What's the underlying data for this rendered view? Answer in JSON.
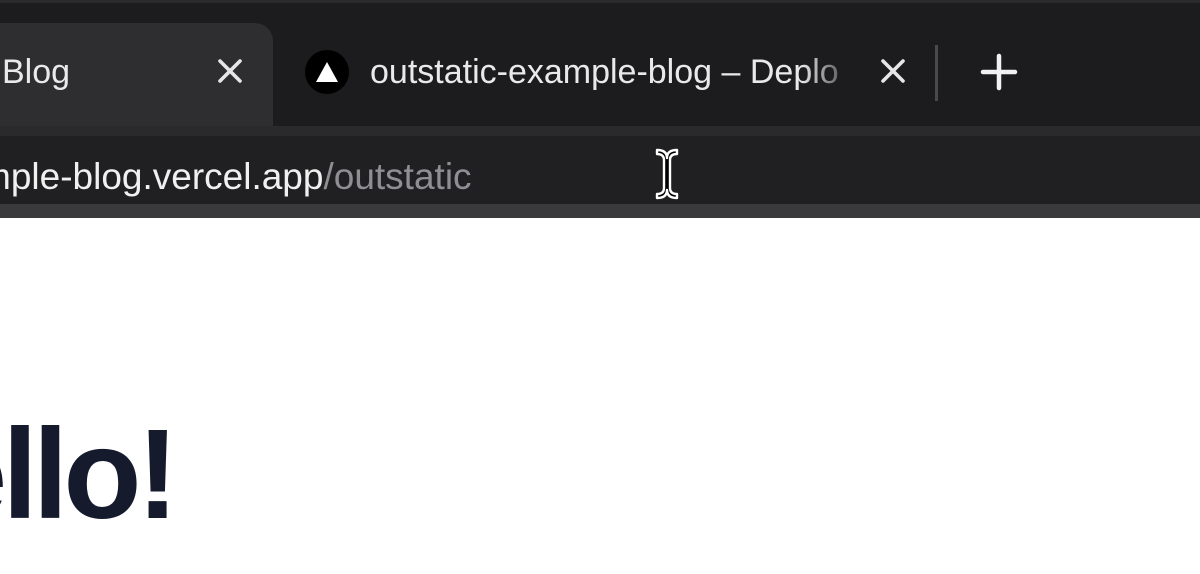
{
  "browser": {
    "tabs": [
      {
        "title": "Blog",
        "active": true
      },
      {
        "title": "outstatic-example-blog – Deplo",
        "active": false,
        "favicon": "vercel-triangle-icon"
      }
    ],
    "new_tab_icon": "plus-icon",
    "close_icon": "close-icon",
    "address_bar": {
      "host": "mple-blog.vercel.app",
      "path": "/outstatic"
    }
  },
  "page": {
    "heading": "ello!"
  },
  "colors": {
    "tabstrip_bg": "#1c1c1e",
    "active_tab_bg": "#2e2e31",
    "address_bar_bg": "#202022",
    "url_text": "#f0f0f0",
    "url_path_text": "#8e8e93",
    "heading_text": "#151a2d"
  }
}
